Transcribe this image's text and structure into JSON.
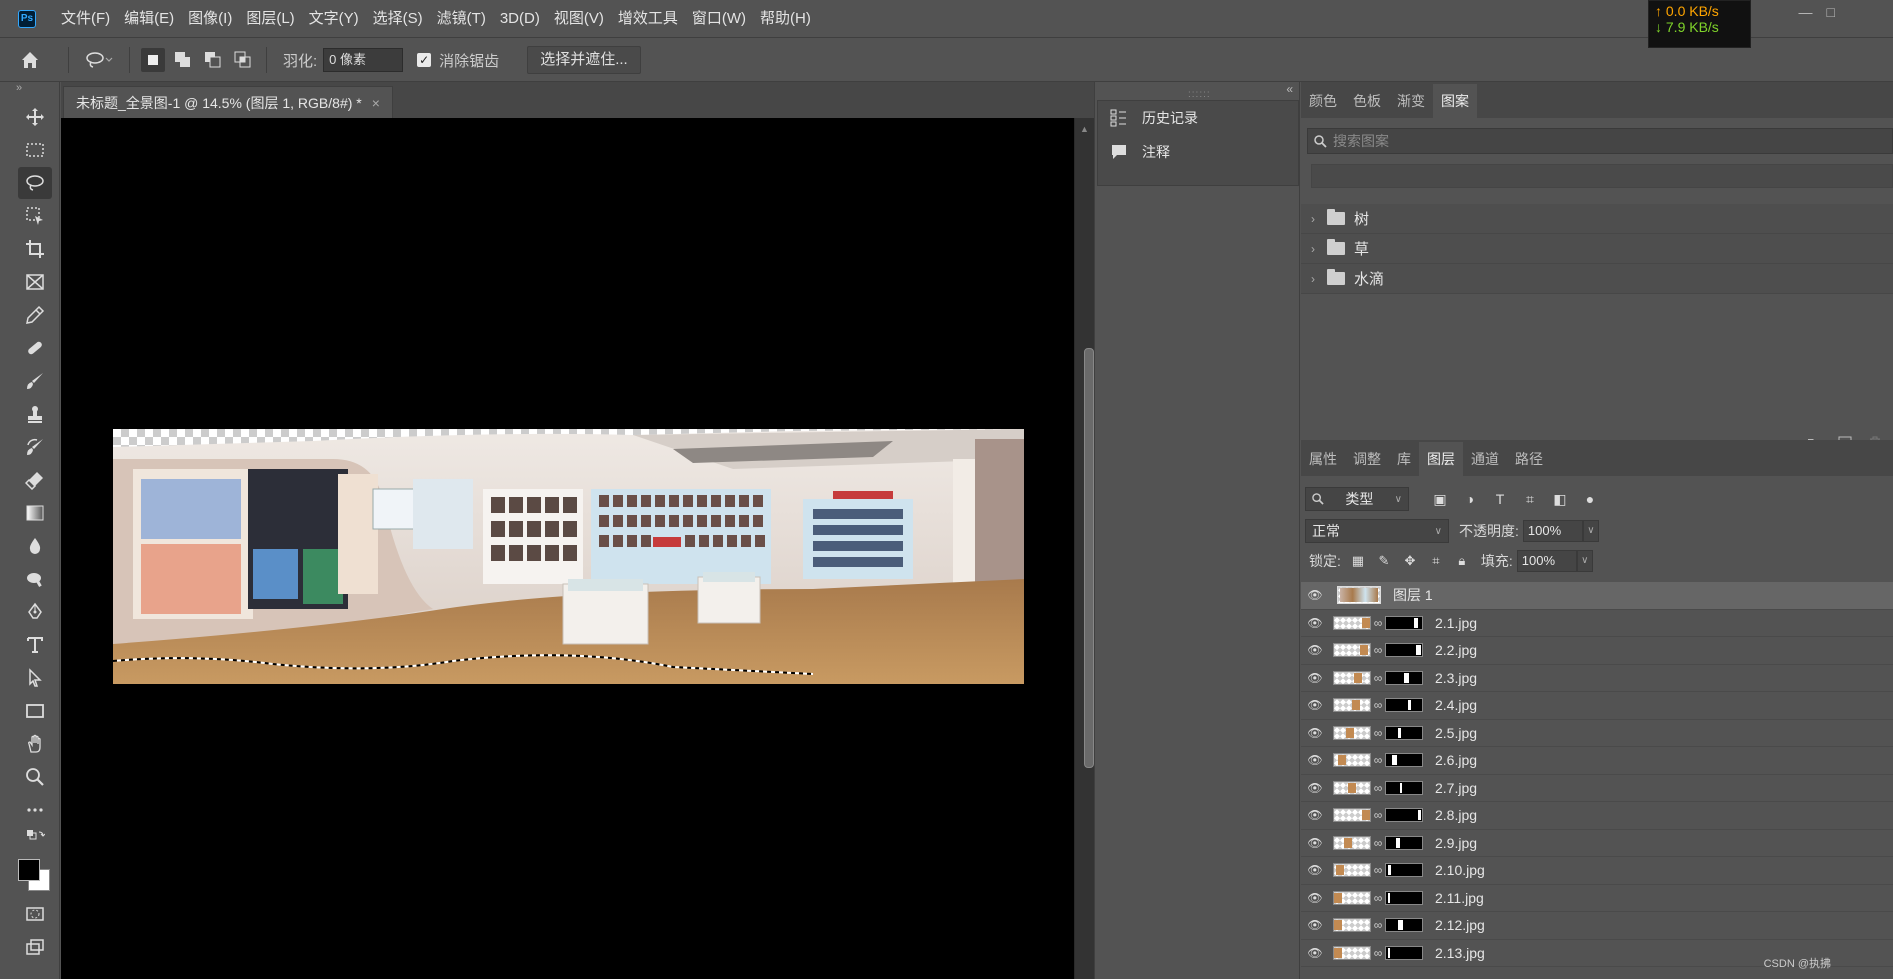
{
  "app": {
    "logo": "Ps",
    "menus": [
      "文件(F)",
      "编辑(E)",
      "图像(I)",
      "图层(L)",
      "文字(Y)",
      "选择(S)",
      "滤镜(T)",
      "3D(D)",
      "视图(V)",
      "增效工具",
      "窗口(W)",
      "帮助(H)"
    ]
  },
  "netspeed": {
    "up": "↑ 0.0 KB/s",
    "down": "↓ 7.9 KB/s"
  },
  "options": {
    "feather_label": "羽化:",
    "feather_value": "0 像素",
    "antialias_label": "消除锯齿",
    "select_mask_label": "选择并遮住..."
  },
  "document": {
    "tab_title": "未标题_全景图-1 @ 14.5% (图层 1, RGB/8#) *",
    "close": "×"
  },
  "mid_panel": {
    "items": [
      {
        "label": "历史记录",
        "icon": "history-icon"
      },
      {
        "label": "注释",
        "icon": "comment-icon"
      }
    ]
  },
  "top_right_tabs": [
    "颜色",
    "色板",
    "渐变",
    "图案"
  ],
  "patterns": {
    "search_placeholder": "搜索图案",
    "groups": [
      "树",
      "草",
      "水滴"
    ]
  },
  "layers_tabs": [
    "属性",
    "调整",
    "库",
    "图层",
    "通道",
    "路径"
  ],
  "layers": {
    "kind_label": "类型",
    "blend_mode": "正常",
    "opacity_label": "不透明度:",
    "opacity_value": "100%",
    "lock_label": "锁定:",
    "fill_label": "填充:",
    "fill_value": "100%",
    "items": [
      {
        "name": "图层 1",
        "selected": true
      },
      {
        "name": "2.1.jpg"
      },
      {
        "name": "2.2.jpg"
      },
      {
        "name": "2.3.jpg"
      },
      {
        "name": "2.4.jpg"
      },
      {
        "name": "2.5.jpg"
      },
      {
        "name": "2.6.jpg"
      },
      {
        "name": "2.7.jpg"
      },
      {
        "name": "2.8.jpg"
      },
      {
        "name": "2.9.jpg"
      },
      {
        "name": "2.10.jpg"
      },
      {
        "name": "2.11.jpg"
      },
      {
        "name": "2.12.jpg"
      },
      {
        "name": "2.13.jpg"
      }
    ]
  },
  "watermark": "CSDN @执拂"
}
